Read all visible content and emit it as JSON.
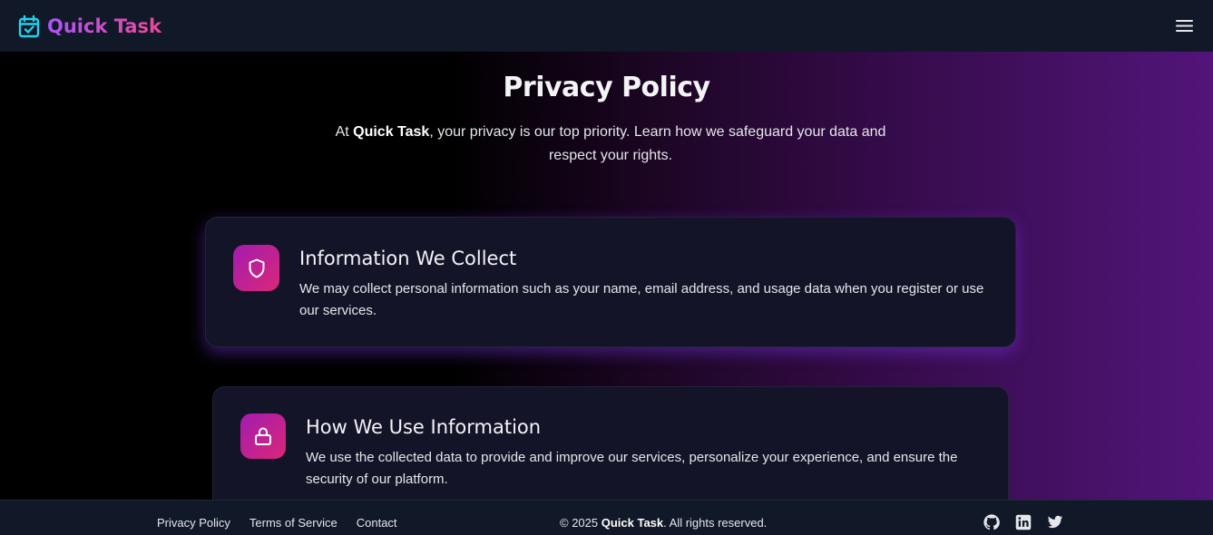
{
  "navbar": {
    "brand_name": "Quick Task",
    "brand_icon": "calendar-check-icon",
    "menu_icon": "hamburger-menu-icon"
  },
  "hero": {
    "title": "Privacy Policy",
    "subtitle_prefix": "At ",
    "subtitle_brand": "Quick Task",
    "subtitle_suffix": ", your privacy is our top priority. Learn how we safeguard your data and respect your rights."
  },
  "sections": [
    {
      "icon": "shield-icon",
      "title": "Information We Collect",
      "text": "We may collect personal information such as your name, email address, and usage data when you register or use our services."
    },
    {
      "icon": "lock-icon",
      "title": "How We Use Information",
      "text": "We use the collected data to provide and improve our services, personalize your experience, and ensure the security of our platform."
    }
  ],
  "footer": {
    "links": [
      "Privacy Policy",
      "Terms of Service",
      "Contact"
    ],
    "copyright_prefix": "© 2025 ",
    "copyright_brand": "Quick Task",
    "copyright_suffix": ". All rights reserved.",
    "social_icons": [
      "github-icon",
      "linkedin-icon",
      "twitter-icon"
    ]
  },
  "colors": {
    "brand_gradient_start": "#a855f7",
    "brand_gradient_end": "#ec4899",
    "brand_icon": "#22d3ee",
    "navbar_bg": "#111827",
    "card_bg": "#141428",
    "page_gradient_end": "#52157a"
  }
}
